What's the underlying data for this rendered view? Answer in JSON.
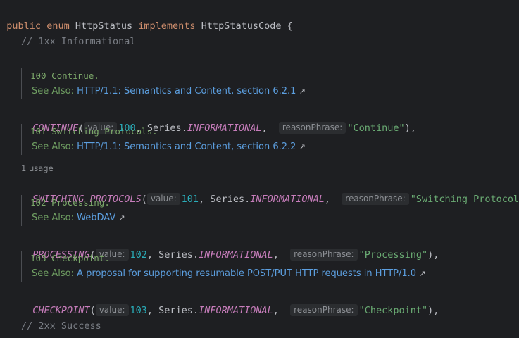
{
  "header": {
    "kw1": "public",
    "kw2": "enum",
    "name": "HttpStatus",
    "kw3": "implements",
    "iface": "HttpStatusCode",
    "brace": "{"
  },
  "comments": {
    "informational": "// 1xx Informational",
    "success": "// 2xx Success"
  },
  "see_also_label": "See Also:",
  "hints": {
    "value": "value:",
    "reason": "reasonPhrase:"
  },
  "series_text": "Series.",
  "series_const": "INFORMATIONAL",
  "usage_label": "1 usage",
  "entries": [
    {
      "doc": "100 Continue.",
      "link": "HTTP/1.1: Semantics and Content, section 6.2.1",
      "name": "CONTINUE",
      "value": "100",
      "reason": "\"Continue\"",
      "end": "),"
    },
    {
      "doc": "101 Switching Protocols.",
      "link": "HTTP/1.1: Semantics and Content, section 6.2.2",
      "name": "SWITCHING_PROTOCOLS",
      "value": "101",
      "reason": "\"Switching Protocols\"",
      "end": "),"
    },
    {
      "doc": "102 Processing.",
      "link": "WebDAV",
      "name": "PROCESSING",
      "value": "102",
      "reason": "\"Processing\"",
      "end": "),"
    },
    {
      "doc": "103 Checkpoint.",
      "link": "A proposal for supporting resumable POST/PUT HTTP requests in HTTP/1.0",
      "name": "CHECKPOINT",
      "value": "103",
      "reason": "\"Checkpoint\"",
      "end": "),"
    }
  ]
}
